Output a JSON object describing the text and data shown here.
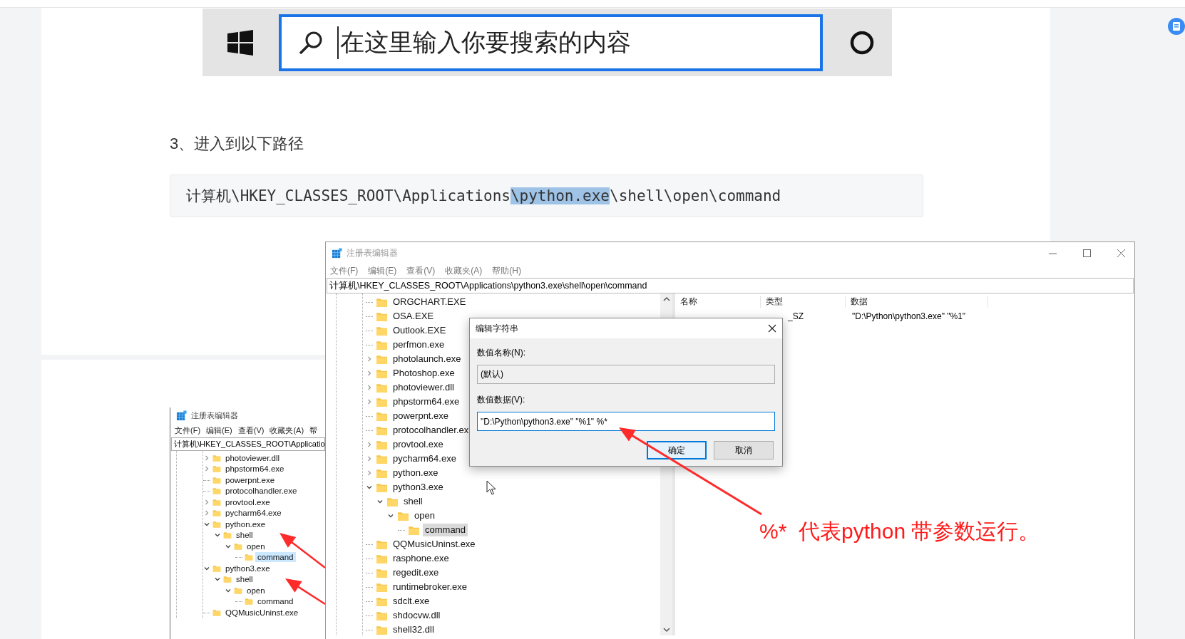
{
  "search_image": {
    "placeholder": "在这里输入你要搜索的内容"
  },
  "step_heading": "3、进入到以下路径",
  "code_block": {
    "text_before": "计算机\\HKEY_CLASSES_ROOT\\Applications",
    "selected_text": "\\python.exe",
    "text_after": "\\shell\\open\\command"
  },
  "regedit": {
    "title": "注册表编辑器",
    "menu": [
      "文件(F)",
      "编辑(E)",
      "查看(V)",
      "收藏夹(A)",
      "帮助(H)"
    ],
    "address": "计算机\\HKEY_CLASSES_ROOT\\Applications\\python3.exe\\shell\\open\\command",
    "tree": [
      {
        "label": "ORGCHART.EXE",
        "kind": "leaf",
        "selected": false
      },
      {
        "label": "OSA.EXE",
        "kind": "leaf",
        "selected": false
      },
      {
        "label": "Outlook.EXE",
        "kind": "leaf",
        "selected": false
      },
      {
        "label": "perfmon.exe",
        "kind": "leaf",
        "selected": false
      },
      {
        "label": "photolaunch.exe",
        "kind": "collapsed",
        "selected": false
      },
      {
        "label": "Photoshop.exe",
        "kind": "collapsed",
        "selected": false
      },
      {
        "label": "photoviewer.dll",
        "kind": "collapsed",
        "selected": false
      },
      {
        "label": "phpstorm64.exe",
        "kind": "collapsed",
        "selected": false
      },
      {
        "label": "powerpnt.exe",
        "kind": "leaf",
        "selected": false
      },
      {
        "label": "protocolhandler.ex",
        "kind": "leaf",
        "selected": false
      },
      {
        "label": "provtool.exe",
        "kind": "collapsed",
        "selected": false
      },
      {
        "label": "pycharm64.exe",
        "kind": "collapsed",
        "selected": false
      },
      {
        "label": "python.exe",
        "kind": "collapsed",
        "selected": false
      },
      {
        "label": "python3.exe",
        "kind": "expanded",
        "selected": false,
        "children": [
          {
            "label": "shell",
            "kind": "expanded",
            "selected": false,
            "children": [
              {
                "label": "open",
                "kind": "expanded",
                "selected": false,
                "children": [
                  {
                    "label": "command",
                    "kind": "leaf",
                    "selected": true
                  }
                ]
              }
            ]
          }
        ]
      },
      {
        "label": "QQMusicUninst.exe",
        "kind": "leaf",
        "selected": false
      },
      {
        "label": "rasphone.exe",
        "kind": "leaf",
        "selected": false
      },
      {
        "label": "regedit.exe",
        "kind": "leaf",
        "selected": false
      },
      {
        "label": "runtimebroker.exe",
        "kind": "leaf",
        "selected": false
      },
      {
        "label": "sdclt.exe",
        "kind": "leaf",
        "selected": false
      },
      {
        "label": "shdocvw.dll",
        "kind": "leaf",
        "selected": false
      },
      {
        "label": "shell32.dll",
        "kind": "leaf",
        "selected": false
      }
    ],
    "columns": [
      "名称",
      "类型",
      "数据"
    ],
    "rows": [
      {
        "type": "_SZ",
        "data": "\"D:\\Python\\python3.exe\" \"%1\""
      }
    ]
  },
  "dialog": {
    "title": "编辑字符串",
    "name_label": "数值名称(N):",
    "name_value": "(默认)",
    "data_label": "数值数据(V):",
    "data_value": "\"D:\\Python\\python3.exe\" \"%1\" %*",
    "buttons": [
      {
        "label": "确定",
        "default": true
      },
      {
        "label": "取消",
        "default": false
      }
    ]
  },
  "annotation": "%*  代表python 带参数运行。",
  "small_screenshot": {
    "title": "注册表编辑器",
    "menu": [
      "文件(F)",
      "编辑(E)",
      "查看(V)",
      "收藏夹(A)",
      "帮"
    ],
    "address": "计算机\\HKEY_CLASSES_ROOT\\Applicatio",
    "tree": [
      {
        "label": "photoviewer.dll",
        "kind": "collapsed",
        "selected": false
      },
      {
        "label": "phpstorm64.exe",
        "kind": "collapsed",
        "selected": false
      },
      {
        "label": "powerpnt.exe",
        "kind": "leaf",
        "selected": false
      },
      {
        "label": "protocolhandler.exe",
        "kind": "leaf",
        "selected": false
      },
      {
        "label": "provtool.exe",
        "kind": "collapsed",
        "selected": false
      },
      {
        "label": "pycharm64.exe",
        "kind": "collapsed",
        "selected": false
      },
      {
        "label": "python.exe",
        "kind": "expanded",
        "selected": false,
        "children": [
          {
            "label": "shell",
            "kind": "expanded",
            "selected": false,
            "children": [
              {
                "label": "open",
                "kind": "expanded",
                "selected": false,
                "children": [
                  {
                    "label": "command",
                    "kind": "leaf",
                    "selected": true
                  }
                ]
              }
            ]
          }
        ]
      },
      {
        "label": "python3.exe",
        "kind": "expanded",
        "selected": false,
        "children": [
          {
            "label": "shell",
            "kind": "expanded",
            "selected": false,
            "children": [
              {
                "label": "open",
                "kind": "expanded",
                "selected": false,
                "children": [
                  {
                    "label": "command",
                    "kind": "leaf",
                    "selected": false
                  }
                ]
              }
            ]
          }
        ]
      },
      {
        "label": "QQMusicUninst.exe",
        "kind": "leaf",
        "selected": false
      }
    ]
  }
}
